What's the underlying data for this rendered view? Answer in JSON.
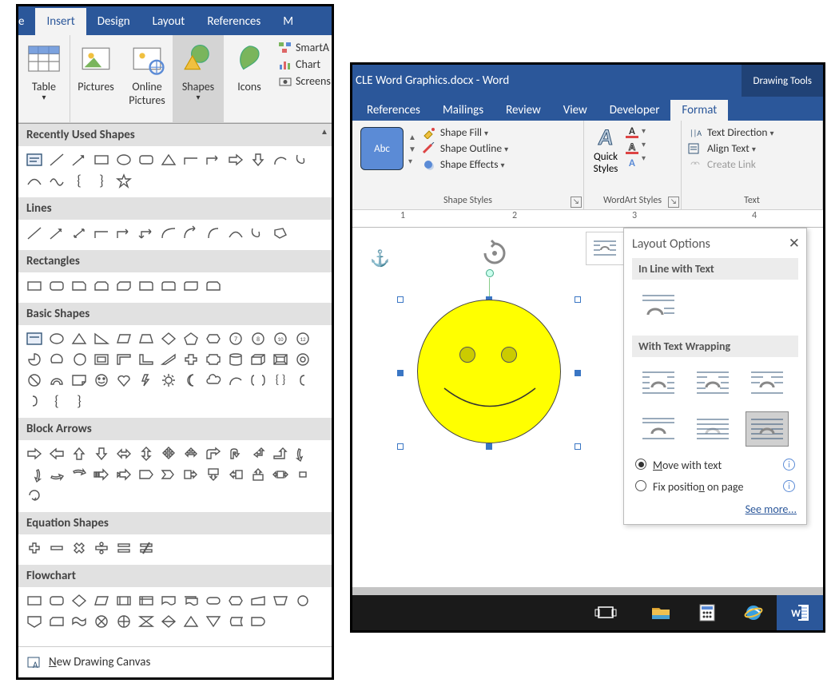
{
  "left": {
    "tabs": {
      "e": "e",
      "insert": "Insert",
      "design": "Design",
      "layout": "Layout",
      "references": "References",
      "m": "M"
    },
    "ribbon": {
      "table": "Table",
      "pictures": "Pictures",
      "online_pictures": "Online\nPictures",
      "shapes": "Shapes",
      "icons": "Icons",
      "smartart": "SmartA",
      "chart": "Chart",
      "screenshot": "Screens"
    },
    "sections": {
      "recent": "Recently Used Shapes",
      "lines": "Lines",
      "rectangles": "Rectangles",
      "basic": "Basic Shapes",
      "block_arrows": "Block Arrows",
      "equation": "Equation Shapes",
      "flowchart": "Flowchart"
    },
    "new_canvas": "New Drawing Canvas"
  },
  "right": {
    "title": "CLE Word Graphics.docx  -  Word",
    "tools": "Drawing Tools",
    "tabs": {
      "references": "References",
      "mailings": "Mailings",
      "review": "Review",
      "view": "View",
      "developer": "Developer",
      "format": "Format"
    },
    "groups": {
      "shape_styles": "Shape Styles",
      "wordart_styles": "WordArt Styles",
      "text": "Text"
    },
    "cmds": {
      "abc": "Abc",
      "shape_fill": "Shape Fill",
      "shape_outline": "Shape Outline",
      "shape_effects": "Shape Effects",
      "quick_styles": "Quick\nStyles",
      "text_direction": "Text Direction",
      "align_text": "Align Text",
      "create_link": "Create Link"
    },
    "ruler": [
      "1",
      "2",
      "3",
      "4"
    ]
  },
  "layout_options": {
    "title": "Layout Options",
    "inline": "In Line with Text",
    "wrapping": "With Text Wrapping",
    "move_with_text": "Move with text",
    "fix_position": "Fix position on page",
    "see_more": "See more..."
  },
  "taskbar": {
    "items": [
      "taskview",
      "file-explorer",
      "calculator",
      "internet-explorer",
      "word"
    ]
  }
}
